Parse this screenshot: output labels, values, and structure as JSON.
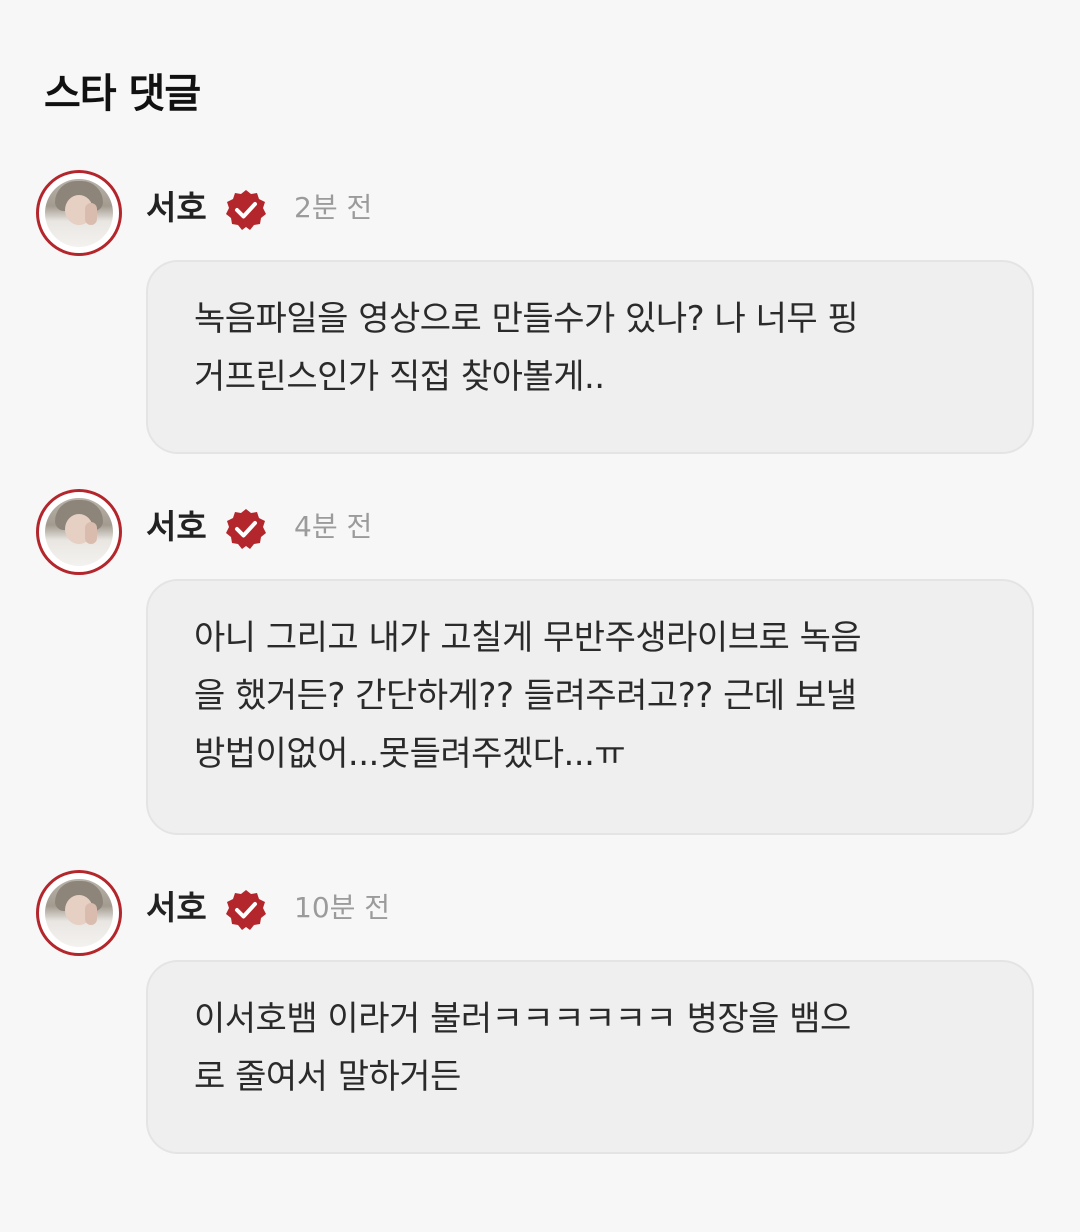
{
  "header": {
    "title": "스타 댓글"
  },
  "colors": {
    "accent_red": "#b3262c",
    "bubble_bg": "#efefef",
    "page_bg": "#f7f7f7",
    "time_gray": "#9b9b9b"
  },
  "comments": [
    {
      "author": "서호",
      "time": "2분 전",
      "verified_icon": "verified-badge-icon",
      "text": "녹음파일을 영상으로 만들수가 있나? 나 너무 핑\n거프린스인가 직접 찾아볼게.."
    },
    {
      "author": "서호",
      "time": "4분 전",
      "verified_icon": "verified-badge-icon",
      "text": "아니 그리고 내가 고칠게 무반주생라이브로 녹음\n을 했거든? 간단하게?? 들려주려고?? 근데 보낼\n방법이없어...못들려주겠다...ㅠ"
    },
    {
      "author": "서호",
      "time": "10분 전",
      "verified_icon": "verified-badge-icon",
      "text": "이서호뱀 이라거 불러ㅋㅋㅋㅋㅋㅋ 병장을 뱀으\n로 줄여서 말하거든"
    }
  ]
}
